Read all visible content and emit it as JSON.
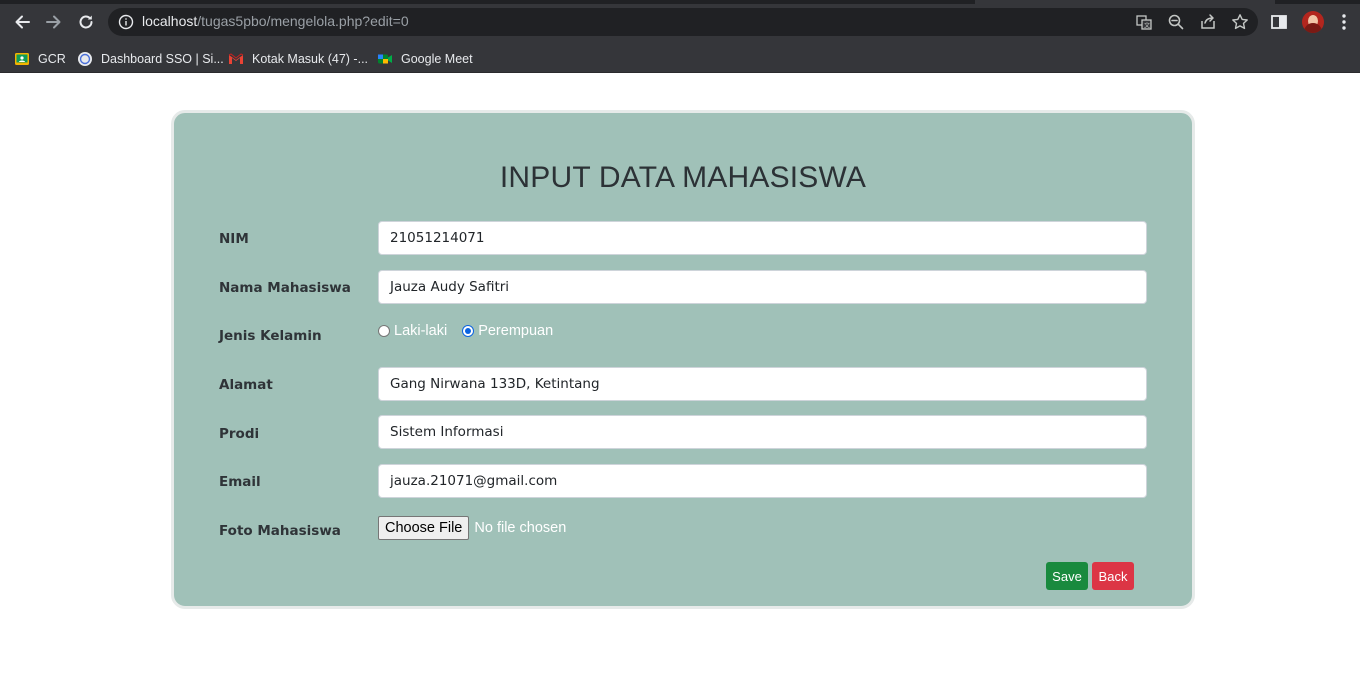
{
  "browser": {
    "url_host": "localhost",
    "url_path": "/tugas5pbo/mengelola.php?edit=0",
    "bookmarks": [
      {
        "label": "GCR",
        "icon": "google-classroom-icon"
      },
      {
        "label": "Dashboard SSO | Si...",
        "icon": "sso-icon"
      },
      {
        "label": "Kotak Masuk (47) -...",
        "icon": "gmail-icon"
      },
      {
        "label": "Google Meet",
        "icon": "google-meet-icon"
      }
    ]
  },
  "form": {
    "title": "INPUT DATA MAHASISWA",
    "nim": {
      "label": "NIM",
      "value": "21051214071"
    },
    "nama": {
      "label": "Nama Mahasiswa",
      "value": "Jauza Audy Safitri"
    },
    "jenis_kelamin": {
      "label": "Jenis Kelamin",
      "options": [
        {
          "label": "Laki-laki",
          "checked": false
        },
        {
          "label": "Perempuan",
          "checked": true
        }
      ]
    },
    "alamat": {
      "label": "Alamat",
      "value": "Gang Nirwana 133D, Ketintang"
    },
    "prodi": {
      "label": "Prodi",
      "value": "Sistem Informasi"
    },
    "email": {
      "label": "Email",
      "value": "jauza.21071@gmail.com"
    },
    "foto": {
      "label": "Foto Mahasiswa",
      "button": "Choose File",
      "status": "No file chosen"
    },
    "save_label": "Save",
    "back_label": "Back"
  },
  "colors": {
    "card_bg": "#a0c1b8",
    "save": "#198a3e",
    "back": "#dc3545"
  }
}
